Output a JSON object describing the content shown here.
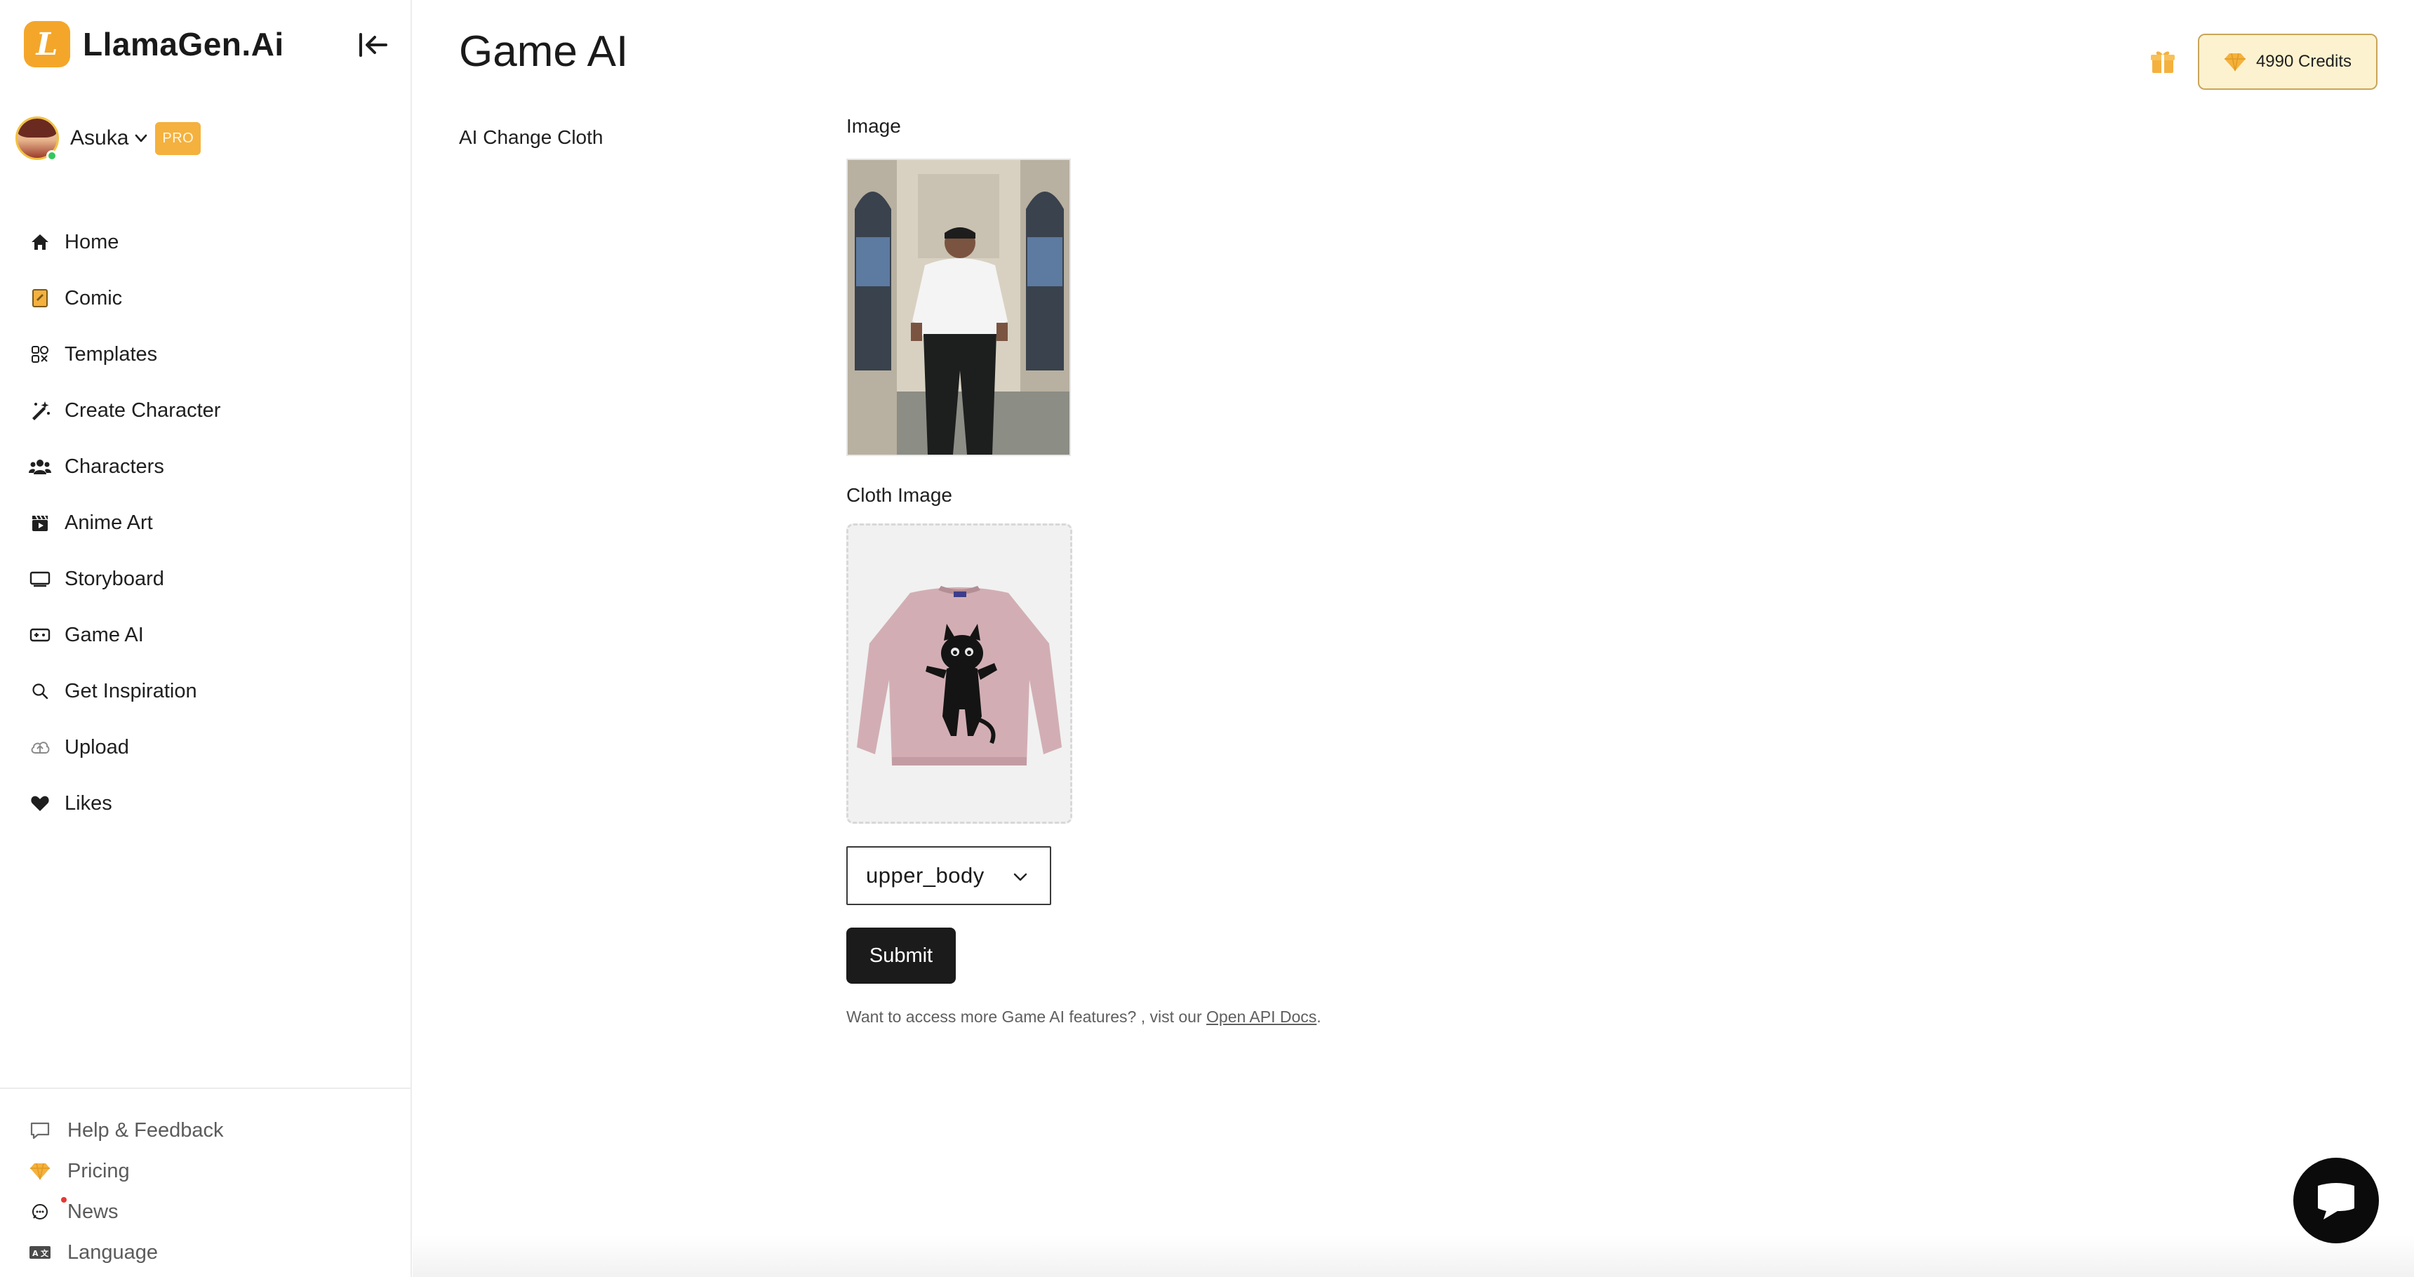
{
  "brand": {
    "mark_letter": "L",
    "name": "LlamaGen.Ai",
    "accent_color": "#f4a62a"
  },
  "user": {
    "name": "Asuka",
    "badge": "PRO",
    "status": "online"
  },
  "sidebar": {
    "items": [
      {
        "label": "Home",
        "icon": "home-icon"
      },
      {
        "label": "Comic",
        "icon": "comic-icon"
      },
      {
        "label": "Templates",
        "icon": "templates-icon"
      },
      {
        "label": "Create Character",
        "icon": "magic-wand-icon"
      },
      {
        "label": "Characters",
        "icon": "users-icon"
      },
      {
        "label": "Anime Art",
        "icon": "clapperboard-icon"
      },
      {
        "label": "Storyboard",
        "icon": "storyboard-icon"
      },
      {
        "label": "Game AI",
        "icon": "gamepad-icon"
      },
      {
        "label": "Get Inspiration",
        "icon": "search-icon"
      },
      {
        "label": "Upload",
        "icon": "upload-icon"
      },
      {
        "label": "Likes",
        "icon": "heart-icon"
      }
    ],
    "footer": [
      {
        "label": "Help & Feedback",
        "icon": "chat-bubble-icon"
      },
      {
        "label": "Pricing",
        "icon": "diamond-icon"
      },
      {
        "label": "News",
        "icon": "news-icon"
      },
      {
        "label": "Language",
        "icon": "language-icon"
      }
    ]
  },
  "header": {
    "title": "Game AI",
    "credits": "4990 Credits"
  },
  "main": {
    "feature": "AI Change Cloth",
    "image_label": "Image",
    "cloth_label": "Cloth Image",
    "cloth_type": "upper_body",
    "submit_label": "Submit",
    "note_prefix": "Want to access more Game AI features? , vist our ",
    "note_link": "Open API Docs",
    "note_suffix": "."
  }
}
